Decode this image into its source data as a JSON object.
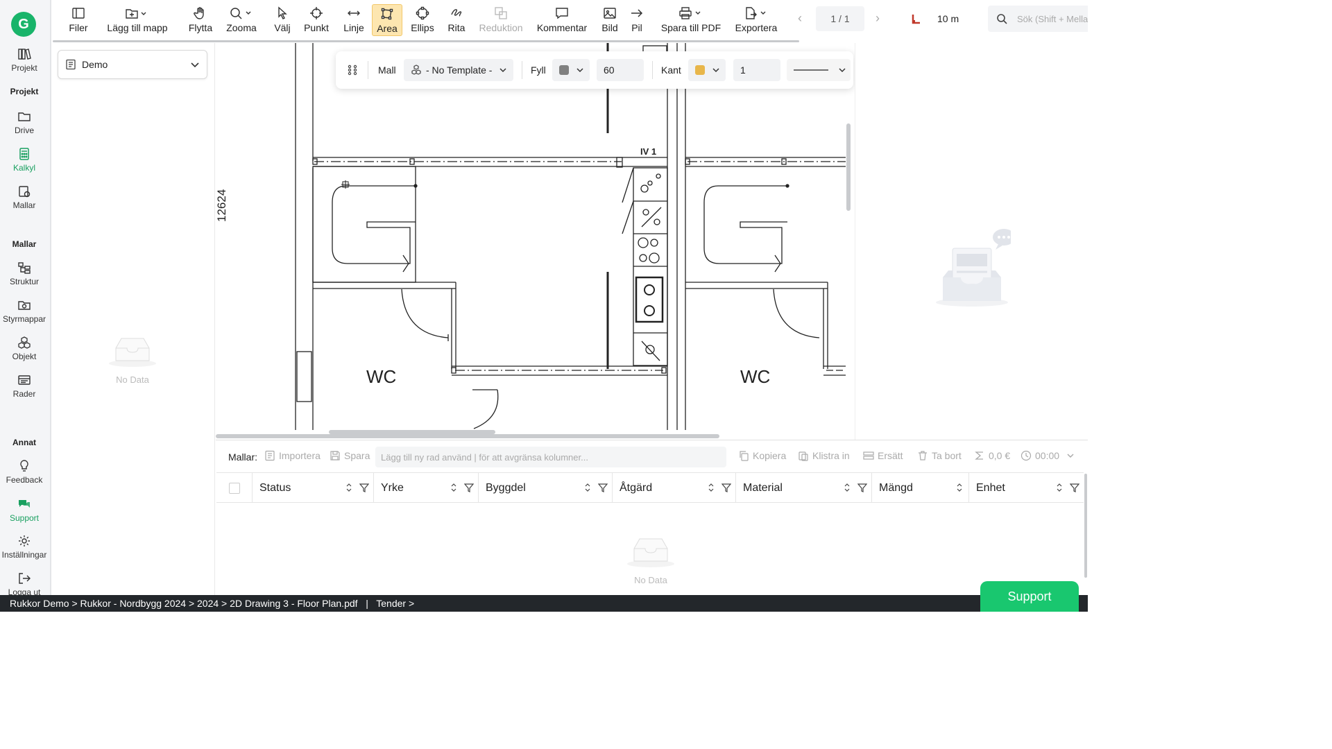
{
  "app": {
    "logo_letter": "G",
    "accent": "#19b46a"
  },
  "rail": {
    "items": [
      {
        "label": "Projekt",
        "icon": "books-icon"
      },
      {
        "section": "Projekt"
      },
      {
        "label": "Drive",
        "icon": "folder-icon"
      },
      {
        "label": "Kalkyl",
        "icon": "calculator-icon",
        "active": true
      },
      {
        "label": "Mallar",
        "icon": "template-icon"
      },
      {
        "section": "Mallar"
      },
      {
        "label": "Struktur",
        "icon": "structure-icon"
      },
      {
        "label": "Styrmappar",
        "icon": "camera-folder-icon"
      },
      {
        "label": "Objekt",
        "icon": "cubes-icon"
      },
      {
        "label": "Rader",
        "icon": "rows-icon"
      },
      {
        "section": "Annat"
      },
      {
        "label": "Feedback",
        "icon": "lightbulb-icon"
      },
      {
        "label": "Support",
        "icon": "chat-icon",
        "active": true
      },
      {
        "label": "Inställningar",
        "icon": "gear-icon"
      },
      {
        "label": "Logga ut",
        "icon": "logout-icon"
      }
    ]
  },
  "toolbar": {
    "filer": "Filer",
    "add_folder": "Lägg till mapp",
    "move": "Flytta",
    "zoom": "Zooma",
    "select": "Välj",
    "point": "Punkt",
    "line": "Linje",
    "area": "Area",
    "ellipse": "Ellips",
    "draw": "Rita",
    "reduction": "Reduktion",
    "comment": "Kommentar",
    "image": "Bild",
    "arrow": "Pil",
    "save_pdf": "Spara till PDF",
    "export": "Exportera",
    "page_indicator": "1 / 1",
    "scale": "10 m",
    "search_placeholder": "Sök (Shift + Mellanslag)"
  },
  "left_panel": {
    "dropdown_value": "Demo",
    "empty_text": "No Data"
  },
  "stylebar": {
    "template_label": "Mall",
    "template_value": "- No Template -",
    "fill_label": "Fyll",
    "fill_color": "#808080",
    "fill_value": "60",
    "border_label": "Kant",
    "border_color": "#e8b64a",
    "border_value": "1"
  },
  "drawing": {
    "dimension_label": "12624",
    "room_label_left": "WC",
    "room_label_right": "WC",
    "wall_tag": "IV 1"
  },
  "bottom": {
    "templates_label": "Mallar:",
    "import": "Importera",
    "save": "Spara",
    "add_row_placeholder": "Lägg till ny rad använd | för att avgränsa kolumner...",
    "copy": "Kopiera",
    "paste": "Klistra in",
    "replace": "Ersätt",
    "delete": "Ta bort",
    "sum": "0,0 €",
    "time": "00:00",
    "columns": [
      "Status",
      "Yrke",
      "Byggdel",
      "Åtgärd",
      "Material",
      "Mängd",
      "Enhet"
    ],
    "empty_text": "No Data"
  },
  "statusbar": {
    "breadcrumb": "Rukkor Demo > Rukkor - Nordbygg 2024 > 2024 > 2D Drawing 3 - Floor Plan.pdf   |   Tender >"
  },
  "support_button": "Support"
}
